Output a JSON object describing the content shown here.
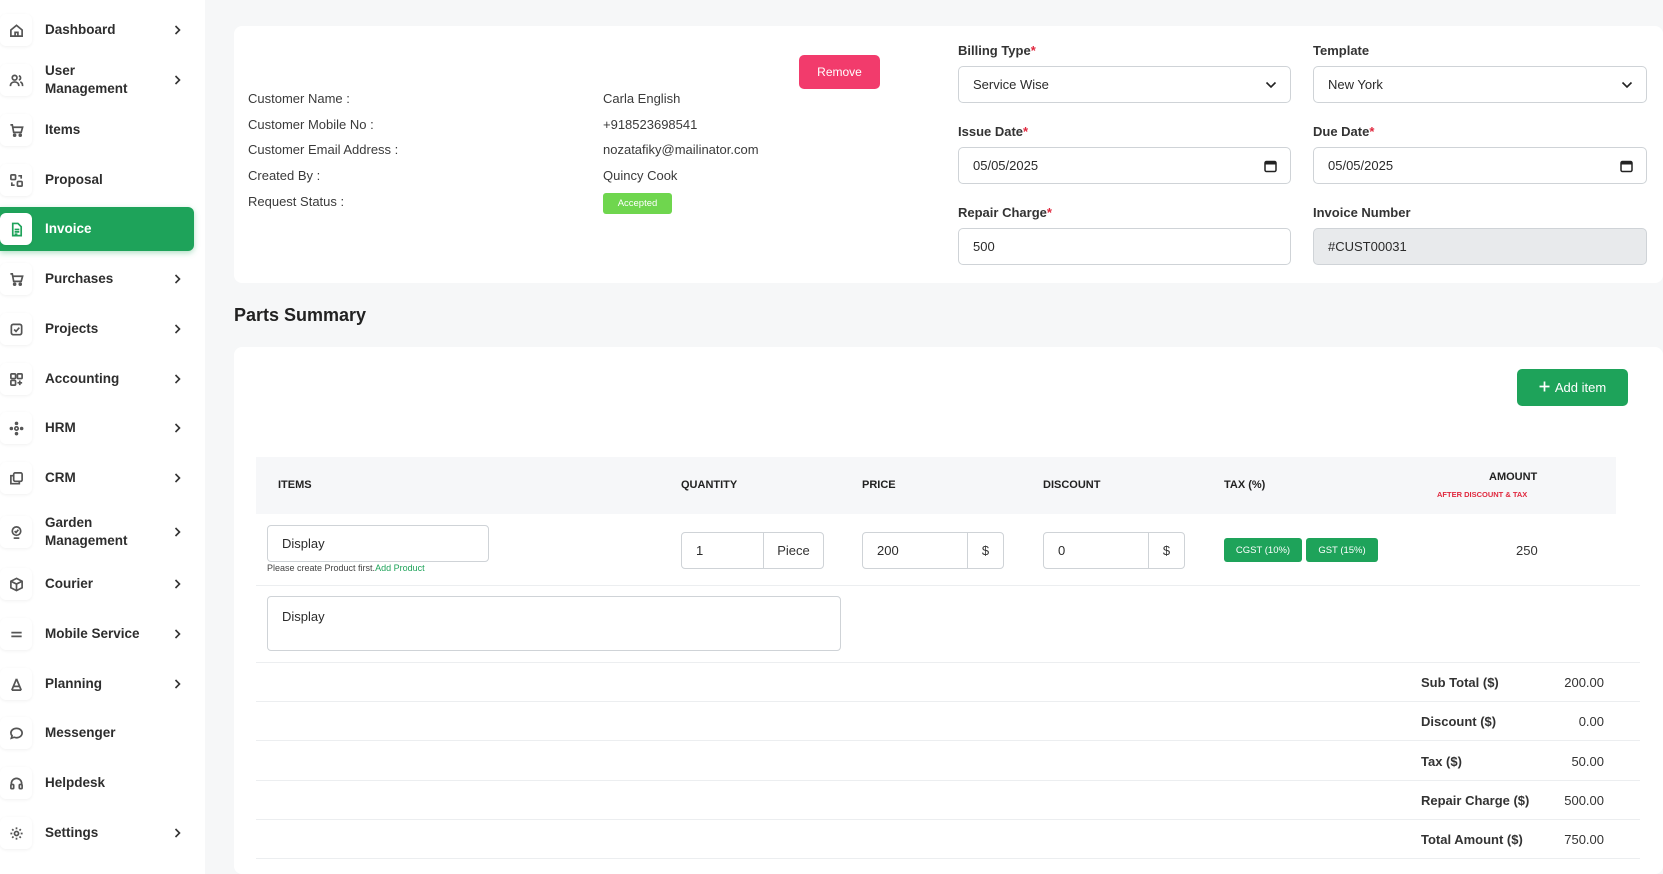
{
  "sidebar": {
    "items": [
      {
        "label": "Dashboard",
        "icon": "home-icon",
        "has_chevron": true
      },
      {
        "label": "User Management",
        "icon": "users-icon",
        "has_chevron": true
      },
      {
        "label": "Items",
        "icon": "cart-icon",
        "has_chevron": false
      },
      {
        "label": "Proposal",
        "icon": "swap-icon",
        "has_chevron": false
      },
      {
        "label": "Invoice",
        "icon": "file-icon",
        "has_chevron": false,
        "active": true
      },
      {
        "label": "Purchases",
        "icon": "cart-icon",
        "has_chevron": true
      },
      {
        "label": "Projects",
        "icon": "checkbox-icon",
        "has_chevron": true
      },
      {
        "label": "Accounting",
        "icon": "grid-icon",
        "has_chevron": true
      },
      {
        "label": "HRM",
        "icon": "nodes-icon",
        "has_chevron": true
      },
      {
        "label": "CRM",
        "icon": "layers-icon",
        "has_chevron": true
      },
      {
        "label": "Garden Management",
        "icon": "plant-icon",
        "has_chevron": true
      },
      {
        "label": "Courier",
        "icon": "box-icon",
        "has_chevron": true
      },
      {
        "label": "Mobile Service",
        "icon": "menu-icon",
        "has_chevron": true
      },
      {
        "label": "Planning",
        "icon": "pen-icon",
        "has_chevron": true
      },
      {
        "label": "Messenger",
        "icon": "chat-icon",
        "has_chevron": false
      },
      {
        "label": "Helpdesk",
        "icon": "headset-icon",
        "has_chevron": false
      },
      {
        "label": "Settings",
        "icon": "gear-icon",
        "has_chevron": true
      }
    ]
  },
  "customer": {
    "name_label": "Customer Name :",
    "name": "Carla English",
    "mobile_label": "Customer Mobile No :",
    "mobile": "+918523698541",
    "email_label": "Customer Email Address :",
    "email": "nozatafiky@mailinator.com",
    "created_label": "Created By :",
    "created_by": "Quincy Cook",
    "status_label": "Request Status :",
    "status": "Accepted",
    "remove_label": "Remove"
  },
  "form": {
    "billing_type_label": "Billing Type",
    "billing_type": "Service Wise",
    "template_label": "Template",
    "template": "New York",
    "issue_date_label": "Issue Date",
    "issue_date": "05/05/2025",
    "due_date_label": "Due Date",
    "due_date": "05/05/2025",
    "repair_charge_label": "Repair Charge",
    "repair_charge": "500",
    "invoice_number_label": "Invoice Number",
    "invoice_number": "#CUST00031",
    "required_mark": "*"
  },
  "parts": {
    "title": "Parts Summary",
    "add_item_label": "Add item",
    "columns": {
      "items": "ITEMS",
      "quantity": "QUANTITY",
      "price": "PRICE",
      "discount": "DISCOUNT",
      "tax": "TAX (%)",
      "amount": "AMOUNT",
      "amount_sub": "AFTER DISCOUNT & TAX"
    },
    "row": {
      "item": "Display",
      "hint": "Please create Product first.",
      "hint_link": "Add Product",
      "quantity": "1",
      "unit": "Piece",
      "price": "200",
      "price_currency": "$",
      "discount": "0",
      "discount_currency": "$",
      "taxes": [
        "CGST (10%)",
        "GST (15%)"
      ],
      "amount": "250",
      "description": "Display"
    },
    "totals": [
      {
        "label": "Sub Total ($)",
        "value": "200.00"
      },
      {
        "label": "Discount ($)",
        "value": "0.00"
      },
      {
        "label": "Tax ($)",
        "value": "50.00"
      },
      {
        "label": "Repair Charge ($)",
        "value": "500.00"
      },
      {
        "label": "Total Amount ($)",
        "value": "750.00"
      }
    ]
  },
  "colors": {
    "accent": "#1ea35a",
    "danger": "#f23b6c",
    "status_accepted": "#6fd64e"
  }
}
